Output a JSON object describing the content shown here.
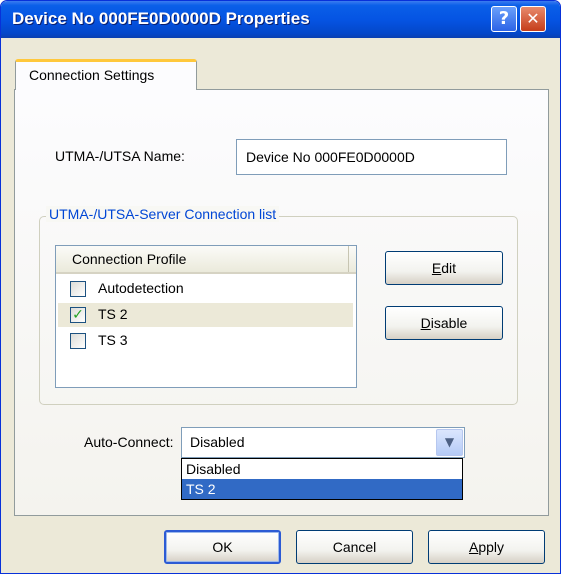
{
  "window": {
    "title": "Device No  000FE0D0000D Properties",
    "help_glyph": "?",
    "close_glyph": "✕"
  },
  "tabs": [
    {
      "label": "Connection Settings",
      "active": true
    }
  ],
  "name_field": {
    "label": "UTMA-/UTSA Name:",
    "value": "Device No  000FE0D0000D"
  },
  "server_group": {
    "legend": "UTMA-/UTSA-Server Connection list",
    "list": {
      "column_header": "Connection Profile",
      "rows": [
        {
          "label": "Autodetection",
          "checked": false,
          "check_glyph": ""
        },
        {
          "label": "TS 2",
          "checked": true,
          "check_glyph": "✓"
        },
        {
          "label": "TS 3",
          "checked": false,
          "check_glyph": ""
        }
      ]
    },
    "edit_button": {
      "pre": "",
      "accel": "E",
      "post": "dit"
    },
    "disable_button": {
      "pre": "",
      "accel": "D",
      "post": "isable"
    }
  },
  "auto_connect": {
    "label": "Auto-Connect:",
    "selected": "Disabled",
    "arrow_glyph": "▼",
    "options": [
      "Disabled",
      "TS 2"
    ],
    "highlighted_option": "TS 2"
  },
  "footer": {
    "ok": "OK",
    "cancel": "Cancel",
    "apply": {
      "pre": "",
      "accel": "A",
      "post": "pply"
    }
  },
  "colors": {
    "title_bar": "#0554e3",
    "window_face": "#ece9d8",
    "group_legend": "#0046d5",
    "selection": "#316ac5",
    "tab_highlight": "#ffc83c"
  }
}
